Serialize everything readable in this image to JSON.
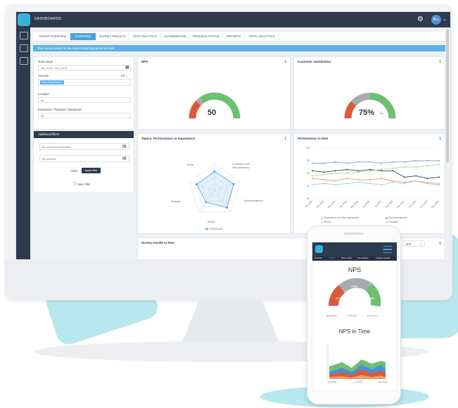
{
  "colors": {
    "accent": "#4aa3df",
    "navy": "#2d3b4d",
    "gaugeRed": "#d95b3a",
    "gaugeGrey": "#a9acaf",
    "gaugeGreen": "#6cc070",
    "bg": "#b9e7ee"
  },
  "app": {
    "title": "DASHBOARDS",
    "avatar": "BLL"
  },
  "tabs": [
    "GROUP OVERVIEW",
    "OVERVIEW",
    "SURVEY RESULTS",
    "TEXT ANALYTICS",
    "LEADERBOARD",
    "PROCESS STATUS",
    "REPORTS",
    "TOPIC ANALYTICS"
  ],
  "notice": "Your survey results for the current reporting period are final.",
  "filters": {
    "time_label": "Time range",
    "time_value": "Jan, 2019 - Dec, 2019",
    "surveys_label": "Surveys",
    "surveys_count": "All ⌄",
    "surveys_chip": "Shop Experience ×",
    "location_label": "Location",
    "location_value": "All",
    "promoters_label": "Promoters / Passives / Detractors",
    "promoters_value": "All",
    "additional_title": "Additional filters",
    "customer_info": "By customer information",
    "by_question": "By question",
    "clear": "Clear",
    "apply": "Apply filter",
    "save": "Save filter"
  },
  "cards": {
    "nps_title": "NPS",
    "nps_value": "50",
    "csat_title": "Customer satisfaction",
    "csat_value": "75%",
    "csat_suffix": "Yes",
    "radar_title": "Topics: Performance vs Importance",
    "line_title": "Performance in time",
    "survey_time_title": "Survey results in time",
    "nps_select": "NPS"
  },
  "radar": {
    "labels": [
      "Arrival",
      "Convenience and\nFirst Impressions",
      "Shop Arrangement",
      "Service",
      "Purchase"
    ],
    "legend": "Performance"
  },
  "chart_data": [
    {
      "type": "gauge",
      "title": "NPS",
      "value": 50,
      "segments": [
        {
          "name": "detractors",
          "value": 25
        },
        {
          "name": "passives",
          "value": 5
        },
        {
          "name": "promoters",
          "value": 70
        }
      ]
    },
    {
      "type": "gauge",
      "title": "Customer satisfaction",
      "value": 75,
      "segments": [
        {
          "name": "no",
          "value": 20
        },
        {
          "name": "neutral",
          "value": 5
        },
        {
          "name": "yes",
          "value": 75
        }
      ]
    },
    {
      "type": "radar",
      "title": "Topics: Performance vs Importance",
      "categories": [
        "Arrival",
        "Convenience and First Impressions",
        "Shop Arrangement",
        "Service",
        "Purchase"
      ],
      "series": [
        {
          "name": "Performance",
          "values": [
            0.7,
            0.75,
            0.8,
            0.55,
            0.7
          ]
        }
      ]
    },
    {
      "type": "line",
      "title": "Performance in time",
      "ylim": [
        60,
        100
      ],
      "categories": [
        "Jan 2019",
        "Feb 2019",
        "Mar 2019",
        "Apr 2019",
        "May 2019",
        "Jun 2019",
        "Jul 2019",
        "Aug 2019",
        "Sep 2019",
        "Oct 2019",
        "Nov 2019",
        "Dec 2019"
      ],
      "series": [
        {
          "name": "Convenience and First Impressions",
          "color": "#8a9fbf",
          "values": [
            88,
            88,
            89,
            88,
            89,
            89,
            88,
            89,
            89,
            90,
            90,
            90
          ]
        },
        {
          "name": "Shop Arrangement",
          "color": "#2e4a6b",
          "values": [
            82,
            81,
            82,
            83,
            82,
            83,
            82,
            82,
            77,
            78,
            76,
            77
          ]
        },
        {
          "name": "Service",
          "color": "#b6d98a",
          "values": [
            78,
            79,
            80,
            80,
            81,
            82,
            83,
            84,
            85,
            85,
            86,
            87
          ]
        },
        {
          "name": "Purchase",
          "color": "#e6a06a",
          "values": [
            76,
            75,
            74,
            76,
            75,
            75,
            76,
            74,
            73,
            74,
            72,
            71
          ]
        },
        {
          "name": "Arrival",
          "color": "#a8c8e8",
          "values": [
            71,
            72,
            71,
            72,
            73,
            72,
            71,
            73,
            72,
            74,
            73,
            72
          ]
        }
      ],
      "yticks": [
        "100",
        "90",
        "80",
        "70",
        "60"
      ]
    },
    {
      "type": "donut",
      "title": "NPS",
      "segments": [
        {
          "name": "Detractor",
          "value": 27
        },
        {
          "name": "Passive",
          "value": 44
        },
        {
          "name": "Promoter",
          "value": 29
        }
      ]
    },
    {
      "type": "area",
      "title": "NPS in Time",
      "categories": [
        "Jan 2019",
        "Jul 2019",
        "Dec 2019"
      ]
    }
  ],
  "line_legend": [
    "Convenience and First Impressions",
    "Shop Arrangement",
    "Service",
    "Purchase",
    "Arrival"
  ],
  "phone": {
    "tabs": [
      "Overview",
      "Results",
      "Driver results",
      "Text Analytics",
      "Customer journal"
    ],
    "nps_title": "NPS",
    "nps_red": "27%",
    "nps_grey": "44%",
    "nps_green": "29%",
    "legend": [
      "Detractor",
      "Passive",
      "Promoter"
    ],
    "time_title": "NPS in Time",
    "xlabels": [
      "Jan 2019",
      "Jul 2019",
      "Dec 2019"
    ]
  }
}
